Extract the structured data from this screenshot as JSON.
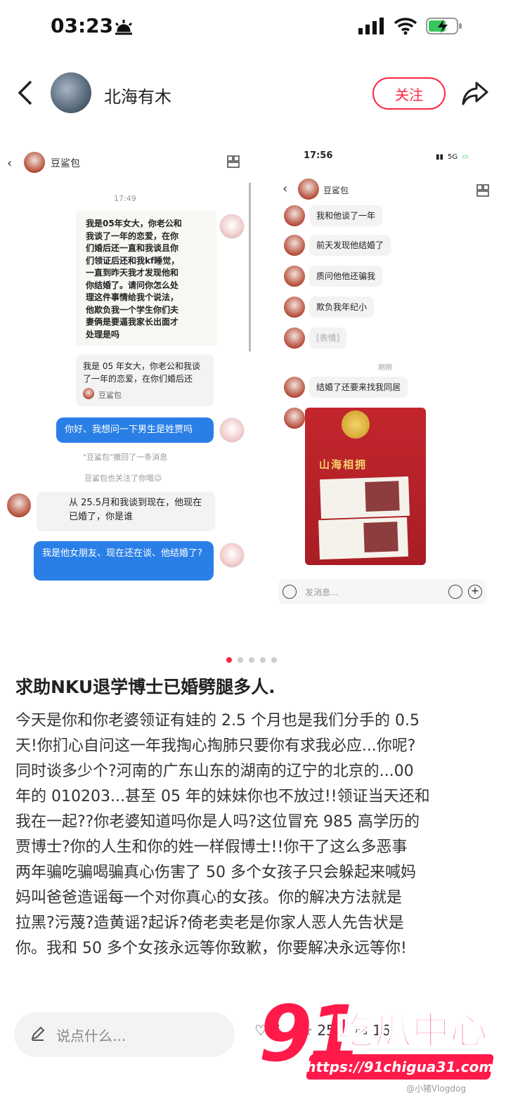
{
  "status_bar": {
    "time": "03:23"
  },
  "header": {
    "author": "北海有木",
    "follow_label": "关注"
  },
  "left_shot": {
    "title": "豆鲨包",
    "time": "17:49",
    "quote_lines": [
      "我是05年女大，你老公和",
      "我谈了一年的恋爱，在你",
      "们婚后还一直和我谈且你",
      "们领证后还和我kf睡觉，",
      "一直到昨天我才发现他和",
      "你结婚了。请问你怎么处",
      "理这件事情给我个说法，",
      "他欺负我一个学生你们夫",
      "妻俩是要逼我家长出面才",
      "处理是吗"
    ],
    "card_text": "我是 05 年女大，你老公和我谈了一年的恋爱，在你们婚后还",
    "card_source": "豆鲨包",
    "blue_msg1": "你好、我想问一下男生是姓贾吗",
    "notice1": "\"豆鲨包\"撤回了一条消息",
    "notice2": "豆鲨包也关注了你哦😉",
    "reply": "从 25.5月和我谈到现在，他现在已婚了，你是谁",
    "blue_msg2": "我是他女朋友、现在还在谈、他结婚了?"
  },
  "right_shot": {
    "time": "17:56",
    "network": "5G",
    "title": "豆鲨包",
    "msgs": [
      "我和他谈了一年",
      "前天发现他结婚了",
      "质问他他还骗我",
      "欺负我年纪小"
    ],
    "blurred": "[表情]",
    "just_now": "刚刚",
    "msg_last": "结婚了还要来找我同居",
    "photo_text": "山海相拥",
    "input_placeholder": "发消息..."
  },
  "post": {
    "title": "求助NKU退学博士已婚劈腿多人.",
    "body_lines": [
      "今天是你和你老婆领证有娃的 2.5 个月也是我们分手的 0.5",
      "天!你扪心自问这一年我掏心掏肺只要你有求我必应...你呢?",
      "同时谈多少个?河南的广东山东的湖南的辽宁的北京的...00",
      "年的 010203...甚至 05 年的妹妹你也不放过!!领证当天还和",
      "我在一起??你老婆知道吗你是人吗?这位冒充 985 高学历的",
      "贾博士?你的人生和你的姓一样假博士!!你干了这么多恶事",
      "两年骗吃骗喝骗真心伤害了 50 多个女孩子只会躲起来喊妈",
      "妈叫爸爸造谣每一个对你真心的女孩。你的解决方法就是",
      "拉黑?污蔑?造黄谣?起诉?倚老卖老是你家人恶人先告状是",
      "你。我和 50 多个女孩永远等你致歉，你要解决永远等你!"
    ]
  },
  "bottom": {
    "comment_placeholder": "说点什么...",
    "likes": "7",
    "collects": "25",
    "comments": "16"
  },
  "watermark": {
    "brand_num": "91",
    "brand_cn": "吃瓜中心",
    "url": "https://91chigua31.com",
    "weibo": "@小猪Vlogdog"
  },
  "colors": {
    "accent": "#ff2442",
    "blue_bubble": "#2a7fe6"
  }
}
